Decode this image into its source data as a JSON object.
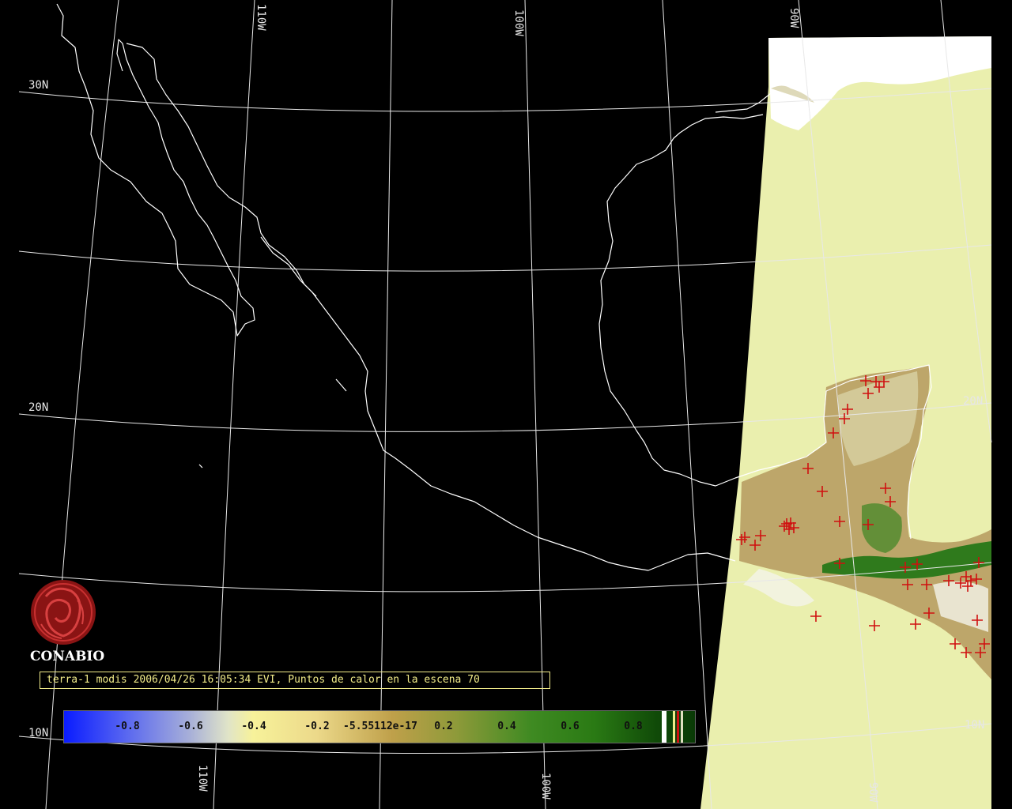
{
  "map": {
    "latitude_labels": [
      "30N",
      "20N",
      "10N"
    ],
    "longitude_labels": [
      "110W",
      "100W",
      "90W"
    ],
    "right_latitude_labels": [
      "20N",
      "10N"
    ],
    "bottom_longitude_labels": [
      "110W",
      "100W",
      "90W"
    ]
  },
  "logo": {
    "name": "CONABIO"
  },
  "caption": "terra-1 modis 2006/04/26 16:05:34 EVI, Puntos de calor en la escena 70",
  "colorbar": {
    "ticks": [
      "-0.8",
      "-0.6",
      "-0.4",
      "-0.2",
      "-5.55112e-17",
      "0.2",
      "0.4",
      "0.6",
      "0.8"
    ]
  },
  "colors": {
    "background": "#000000",
    "scene": "#eaefae",
    "hotspot": "#d01010",
    "vegetation": "#2f7a1c",
    "coastline": "#ffffff",
    "caption_border": "#f2ec8a"
  },
  "legend": {
    "type": "color-scale",
    "min": -0.8,
    "max": 0.8
  },
  "hotspots_count": 70
}
